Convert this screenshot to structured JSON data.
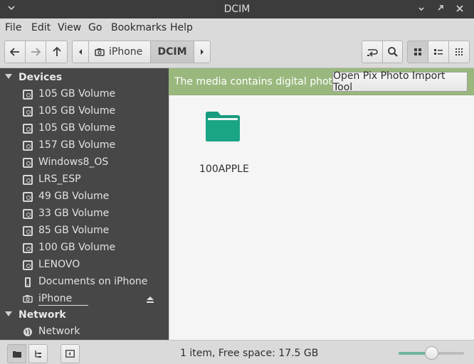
{
  "window": {
    "title": "DCIM"
  },
  "menu": {
    "items": [
      "File",
      "Edit",
      "View",
      "Go",
      "Bookmarks",
      "Help"
    ]
  },
  "toolbar": {
    "back_icon": "arrow-left-icon",
    "forward_icon": "arrow-right-icon",
    "up_icon": "arrow-up-icon",
    "breadcrumb": [
      "iPhone",
      "DCIM"
    ],
    "breadcrumb_icon": "camera-icon",
    "toggle_location_icon": "toggle-location-icon",
    "search_icon": "search-icon",
    "view_modes": [
      "icon-view",
      "list-view",
      "compact-view"
    ],
    "active_view": "icon-view"
  },
  "sidebar": {
    "sections": [
      {
        "title": "Devices",
        "items": [
          {
            "label": "105 GB Volume",
            "icon": "disk-icon"
          },
          {
            "label": "105 GB Volume",
            "icon": "disk-icon"
          },
          {
            "label": "105 GB Volume",
            "icon": "disk-icon"
          },
          {
            "label": "157 GB Volume",
            "icon": "disk-icon"
          },
          {
            "label": "Windows8_OS",
            "icon": "disk-icon"
          },
          {
            "label": "LRS_ESP",
            "icon": "disk-icon"
          },
          {
            "label": "49 GB Volume",
            "icon": "disk-icon"
          },
          {
            "label": "33 GB Volume",
            "icon": "disk-icon"
          },
          {
            "label": "85 GB Volume",
            "icon": "disk-icon"
          },
          {
            "label": "100 GB Volume",
            "icon": "disk-icon"
          },
          {
            "label": "LENOVO",
            "icon": "disk-icon"
          },
          {
            "label": "Documents on iPhone",
            "icon": "phone-icon"
          },
          {
            "label": "iPhone",
            "icon": "camera-icon",
            "eject": true
          }
        ]
      },
      {
        "title": "Network",
        "items": [
          {
            "label": "Network",
            "icon": "network-icon"
          }
        ]
      }
    ]
  },
  "infobar": {
    "message": "The media contains digital photos.",
    "button_label": "Open Pix Photo Import Tool",
    "color": "#9ab87e"
  },
  "content": {
    "items": [
      {
        "name": "100APPLE",
        "icon": "folder-icon",
        "color": "#179b7e"
      }
    ]
  },
  "statusbar": {
    "text": "1 item, Free space: 17.5 GB",
    "zoom_level": 0.5,
    "accent": "#6fb59b"
  }
}
